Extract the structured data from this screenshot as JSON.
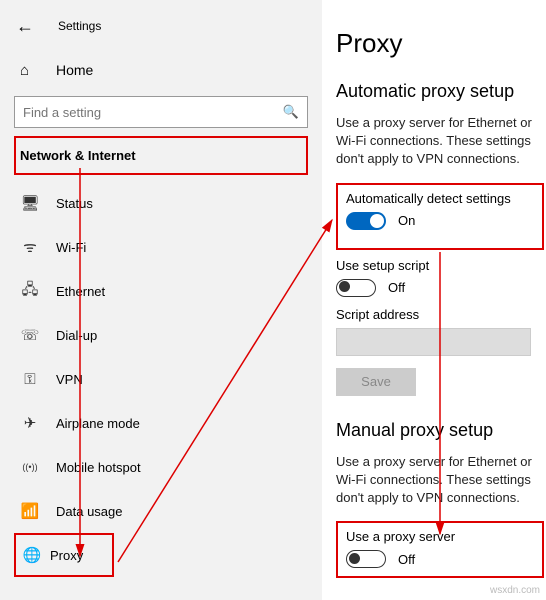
{
  "header": {
    "title": "Settings"
  },
  "home": {
    "label": "Home"
  },
  "search": {
    "placeholder": "Find a setting"
  },
  "section": {
    "label": "Network & Internet"
  },
  "nav": {
    "items": [
      {
        "icon": "🖥",
        "label": "Status"
      },
      {
        "icon": "ᯤ",
        "label": "Wi-Fi"
      },
      {
        "icon": "🖧",
        "label": "Ethernet"
      },
      {
        "icon": "☏",
        "label": "Dial-up"
      },
      {
        "icon": "⚿",
        "label": "VPN"
      },
      {
        "icon": "✈",
        "label": "Airplane mode"
      },
      {
        "icon": "((•))",
        "label": "Mobile hotspot"
      },
      {
        "icon": "📶",
        "label": "Data usage"
      },
      {
        "icon": "🌐",
        "label": "Proxy"
      }
    ]
  },
  "page": {
    "title": "Proxy",
    "auto": {
      "heading": "Automatic proxy setup",
      "desc": "Use a proxy server for Ethernet or Wi-Fi connections. These settings don't apply to VPN connections.",
      "detect_label": "Automatically detect settings",
      "detect_state": "On",
      "script_label": "Use setup script",
      "script_state": "Off",
      "addr_label": "Script address",
      "save": "Save"
    },
    "manual": {
      "heading": "Manual proxy setup",
      "desc": "Use a proxy server for Ethernet or Wi-Fi connections. These settings don't apply to VPN connections.",
      "use_label": "Use a proxy server",
      "use_state": "Off"
    }
  },
  "watermark": "wsxdn.com"
}
